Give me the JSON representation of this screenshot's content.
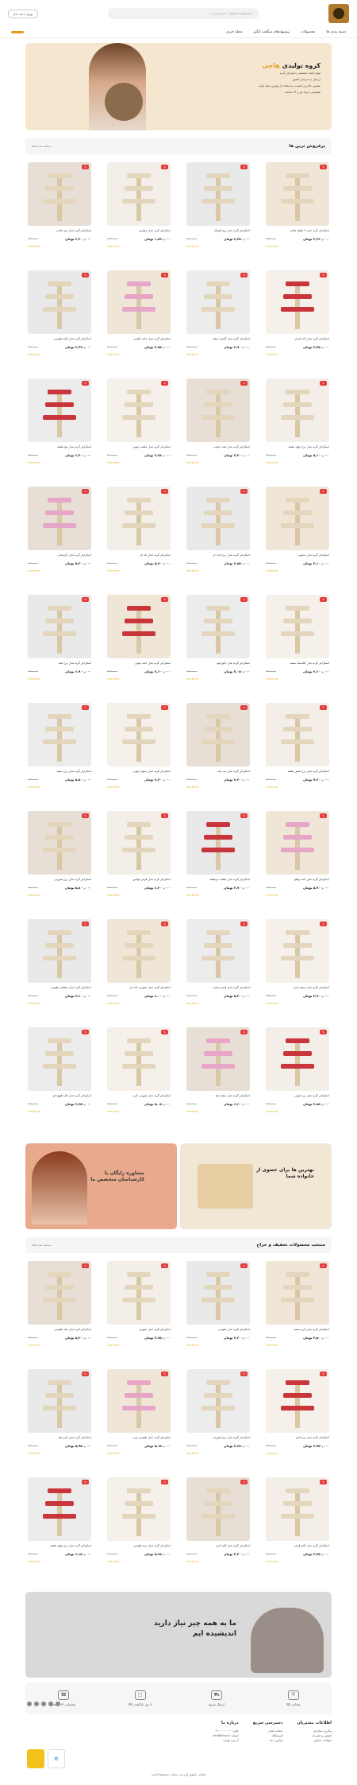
{
  "header": {
    "login_label": "ورود | ثبت نام",
    "search_placeholder": "جستجوی محصول، دسته و برند...",
    "cart_count": "0"
  },
  "nav": {
    "items": [
      "دسته بندی ها",
      "محصولات",
      "پیشنهادهای شگفت انگیز",
      "مجله خبری"
    ]
  },
  "hero": {
    "title_a": "کروه تولیدی",
    "title_b": "هاجی",
    "lines": [
      "تولید کننده تخصصی اسکراچر گربه",
      "ارسال به سراسر کشور",
      "تضمین بالاترین کیفیت و استفاده از بهترین مواد اولیه",
      "پشتیبانی حرفه ای و ۲۴ ساعته"
    ]
  },
  "section1": {
    "title": "پرفروش ترین ها",
    "more": "مشاهده همه کالاها"
  },
  "products": [
    {
      "name": "اسکراچر گربه مدل ۳ طبقه هاجی",
      "price": "۳,۶۲۰,۰۰۰ تومان",
      "old": "۳,۹۲۰,۰۰۰"
    },
    {
      "name": "اسکراچر گربه مدل برج کوچک",
      "price": "۲,۴۵۰,۰۰۰ تومان",
      "old": "۲,۹۰۰,۰۰۰"
    },
    {
      "name": "اسکراچر گربه مدل دیواری",
      "price": "۱,۸۹۰,۰۰۰ تومان",
      "old": "۲,۱۵۰,۰۰۰"
    },
    {
      "name": "اسکراچر گربه مدل میز هاجی",
      "price": "۲,۲۰۰,۰۰۰ تومان",
      "old": "۲,۶۰۰,۰۰۰"
    },
    {
      "name": "اسکراچر گربه مدل لانه قرمز",
      "price": "۴,۳۵۰,۰۰۰ تومان",
      "old": "۴,۸۰۰,۰۰۰"
    },
    {
      "name": "اسکراچر گربه مدل گنبدی سفید",
      "price": "۳,۹۰۰,۰۰۰ تومان",
      "old": "۴,۲۰۰,۰۰۰"
    },
    {
      "name": "اسکراچر گربه مدل خانه مکعبی",
      "price": "۲,۷۵۰,۰۰۰ تومان",
      "old": "۳,۰۵۰,۰۰۰"
    },
    {
      "name": "اسکراچر گربه مدل کلبه طوسی",
      "price": "۲,۴۹۰,۰۰۰ تومان",
      "old": "۲,۸۰۰,۰۰۰"
    },
    {
      "name": "اسکراچر گربه مدل برج چهار طبقه",
      "price": "۵,۱۰۰,۰۰۰ تومان",
      "old": "۵,۶۰۰,۰۰۰"
    },
    {
      "name": "اسکراچر گربه مدل تخت خواب",
      "price": "۳,۳۰۰,۰۰۰ تومان",
      "old": "۳,۷۰۰,۰۰۰"
    },
    {
      "name": "اسکراچر گربه مدل مکعب چوبی",
      "price": "۲,۹۸۰,۰۰۰ تومان",
      "old": "۳,۲۰۰,۰۰۰"
    },
    {
      "name": "اسکراچر گربه مدل پنج طبقه",
      "price": "۶,۴۰۰,۰۰۰ تومان",
      "old": "۶,۹۰۰,۰۰۰"
    },
    {
      "name": "اسکراچر گربه مدل ستونی",
      "price": "۴,۱۰۰,۰۰۰ تومان",
      "old": "۴,۵۰۰,۰۰۰"
    },
    {
      "name": "اسکراچر گربه مدل برج لانه دار",
      "price": "۴,۸۵۰,۰۰۰ تومان",
      "old": "۵,۳۰۰,۰۰۰"
    },
    {
      "name": "اسکراچر گربه مدل پله ای",
      "price": "۵,۷۰۰,۰۰۰ تومان",
      "old": "۶,۱۰۰,۰۰۰"
    },
    {
      "name": "اسکراچر گربه مدل آپارتمانی",
      "price": "۵,۲۰۰,۰۰۰ تومان",
      "old": "۵,۶۰۰,۰۰۰"
    },
    {
      "name": "اسکراچر گربه مدل کلاسیک سفید",
      "price": "۳,۶۰۰,۰۰۰ تومان",
      "old": "۳,۹۰۰,۰۰۰"
    },
    {
      "name": "اسکراچر گربه مدل دکوراتیو",
      "price": "۳,۰۵۰,۰۰۰ تومان",
      "old": "۳,۴۰۰,۰۰۰"
    },
    {
      "name": "اسکراچر گربه مدل خانه چوبی",
      "price": "۲,۶۰۰,۰۰۰ تومان",
      "old": "۲,۹۵۰,۰۰۰"
    },
    {
      "name": "اسکراچر گربه مدل برج بلند",
      "price": "۶,۹۰۰,۰۰۰ تومان",
      "old": "۷,۴۰۰,۰۰۰"
    },
    {
      "name": "اسکراچر گربه مدل برج شش طبقه",
      "price": "۷,۳۰۰,۰۰۰ تومان",
      "old": "۷,۸۰۰,۰۰۰"
    },
    {
      "name": "اسکراچر گربه مدل سه پایه",
      "price": "۴,۴۰۰,۰۰۰ تومان",
      "old": "۴,۹۰۰,۰۰۰"
    },
    {
      "name": "اسکراچر گربه مدل ستون چوبی",
      "price": "۲,۳۰۰,۰۰۰ تومان",
      "old": "۲,۶۰۰,۰۰۰"
    },
    {
      "name": "اسکراچر گربه مدل برج سفید",
      "price": "۵,۵۰۰,۰۰۰ تومان",
      "old": "۵,۹۰۰,۰۰۰"
    },
    {
      "name": "اسکراچر گربه مدل لانه دوقلو",
      "price": "۵,۹۰۰,۰۰۰ تومان",
      "old": "۶,۳۰۰,۰۰۰"
    },
    {
      "name": "اسکراچر گربه مدل مکعب دوطبقه",
      "price": "۴,۷۰۰,۰۰۰ تومان",
      "old": "۵,۱۰۰,۰۰۰"
    },
    {
      "name": "اسکراچر گربه مدل قرمز لوکس",
      "price": "۶,۲۰۰,۰۰۰ تومان",
      "old": "۶,۷۰۰,۰۰۰"
    },
    {
      "name": "اسکراچر گربه مدل برج صورتی",
      "price": "۵,۸۰۰,۰۰۰ تومان",
      "old": "۶,۲۰۰,۰۰۰"
    },
    {
      "name": "اسکراچر گربه مدل سفید کرم",
      "price": "۴,۹۰۰,۰۰۰ تومان",
      "old": "۵,۳۰۰,۰۰۰"
    },
    {
      "name": "اسکراچر گربه مدل قرمز سفید",
      "price": "۵,۴۰۰,۰۰۰ تومان",
      "old": "۵,۸۰۰,۰۰۰"
    },
    {
      "name": "اسکراچر گربه مدل صورتی لانه دار",
      "price": "۶,۰۰۰,۰۰۰ تومان",
      "old": "۶,۵۰۰,۰۰۰"
    },
    {
      "name": "اسکراچر گربه مدل مشکی طوسی",
      "price": "۴,۶۰۰,۰۰۰ تومان",
      "old": "۵,۰۰۰,۰۰۰"
    },
    {
      "name": "اسکراچر گربه مدل برج چوبی",
      "price": "۳,۸۵۰,۰۰۰ تومان",
      "old": "۴,۲۰۰,۰۰۰"
    },
    {
      "name": "اسکراچر گربه مدل سفید بلند",
      "price": "۶,۶۰۰,۰۰۰ تومان",
      "old": "۷,۰۰۰,۰۰۰"
    },
    {
      "name": "اسکراچر گربه مدل صورتی کرم",
      "price": "۵,۰۵۰,۰۰۰ تومان",
      "old": "۵,۴۰۰,۰۰۰"
    },
    {
      "name": "اسکراچر گربه مدل کلبه قهوه ای",
      "price": "۴,۲۵۰,۰۰۰ تومان",
      "old": "۴,۶۰۰,۰۰۰"
    }
  ],
  "banners": {
    "left": "مشاوره رایگان با کارشناسان متخصص ما",
    "right": "بهترین ها برای عضوی از خانواده شما"
  },
  "section2": {
    "title": "منتخب محصولات تخفیف و حراج",
    "more": "مشاهده همه کالاها"
  },
  "products2": [
    {
      "name": "اسکراچر گربه مدل کرم سفید",
      "price": "۴,۵۰۰,۰۰۰ تومان",
      "old": "۴,۹۰۰,۰۰۰"
    },
    {
      "name": "اسکراچر گربه مدل طوسی",
      "price": "۴,۲۰۰,۰۰۰ تومان",
      "old": "۴,۶۰۰,۰۰۰"
    },
    {
      "name": "اسکراچر گربه مدل صورتی",
      "price": "۴,۷۵۰,۰۰۰ تومان",
      "old": "۵,۲۰۰,۰۰۰"
    },
    {
      "name": "اسکراچر گربه مدل بلند طوسی",
      "price": "۵,۳۰۰,۰۰۰ تومان",
      "old": "۵,۷۰۰,۰۰۰"
    },
    {
      "name": "اسکراچر گربه مدل برج کرم",
      "price": "۳,۹۵۰,۰۰۰ تومان",
      "old": "۴,۳۰۰,۰۰۰"
    },
    {
      "name": "اسکراچر گربه مدل برج صورتی",
      "price": "۴,۶۵۰,۰۰۰ تومان",
      "old": "۵,۰۰۰,۰۰۰"
    },
    {
      "name": "اسکراچر گربه مدل طوسی تیره",
      "price": "۵,۱۵۰,۰۰۰ تومان",
      "old": "۵,۵۰۰,۰۰۰"
    },
    {
      "name": "اسکراچر گربه مدل کرم بلند",
      "price": "۵,۹۵۰,۰۰۰ تومان",
      "old": "۶,۴۰۰,۰۰۰"
    },
    {
      "name": "اسکراچر گربه مدل کلبه قرمز",
      "price": "۳,۴۵۰,۰۰۰ تومان",
      "old": "۳,۸۰۰,۰۰۰"
    },
    {
      "name": "اسکراچر گربه مدل کلبه کرم",
      "price": "۳,۲۰۰,۰۰۰ تومان",
      "old": "۳,۶۰۰,۰۰۰"
    },
    {
      "name": "اسکراچر گربه مدل برج طوسی",
      "price": "۵,۶۵۰,۰۰۰ تومان",
      "old": "۶,۰۰۰,۰۰۰"
    },
    {
      "name": "اسکراچر گربه مدل برج چهار طبقه",
      "price": "۶,۱۵۰,۰۰۰ تومان",
      "old": "۶,۶۰۰,۰۰۰"
    }
  ],
  "bottom_banner": {
    "text": "ما به همه چیز نیاز دارید اندیشیده ایم"
  },
  "features": [
    {
      "icon": "shield-icon",
      "label": "ضمانت کالا"
    },
    {
      "icon": "truck-icon",
      "label": "ارسال سریع"
    },
    {
      "icon": "box-icon",
      "label": "۷ روز بازگشت کالا"
    },
    {
      "icon": "headset-icon",
      "label": "پشتیبانی ۲۴ ساعته"
    }
  ],
  "footer": {
    "about_title": "درباره ما",
    "about_lines": [
      "تلفن: ۰۲۱۰۰۰۰۰۰۰۰",
      "ایمیل: info@shop.ir",
      "آدرس: تهران"
    ],
    "links_title": "دسترسی سریع",
    "links": [
      "صفحه اصلی",
      "فروشگاه",
      "تماس با ما"
    ],
    "info_title": "اطلاعات مشتریان",
    "info": [
      "پیگیری سفارش",
      "قوانین و مقررات",
      "سوالات متداول"
    ],
    "copyright": "تمامی حقوق این وب سایت محفوظ است"
  },
  "colors": {
    "accent": "#e89a1c",
    "badge": "#e23c3c",
    "star": "#e8b21e"
  }
}
